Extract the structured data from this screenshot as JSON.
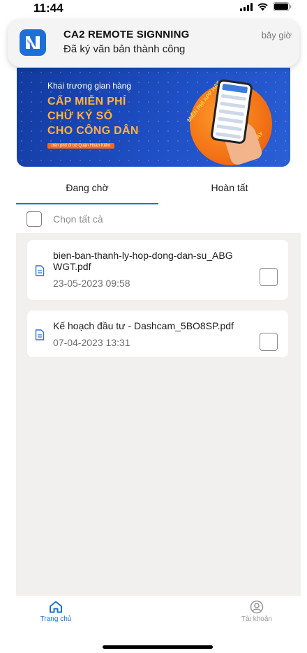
{
  "status_bar": {
    "time": "11:44"
  },
  "notification": {
    "app_name": "CA2 REMOTE SIGNNING",
    "message": "Đã ký văn bản thành công",
    "time": "bây giờ",
    "icon": "app-logo-icon"
  },
  "promo": {
    "kicker": "Khai trương gian hàng",
    "line1": "CẤP MIỄN PHÍ",
    "line2": "CHỮ KÝ SỐ",
    "line3": "CHO CÔNG DÂN",
    "tag": "trên phố đi bộ Quận Hoàn Kiếm",
    "ring_top": "MIỄN PHÍ APP HAY",
    "ring_bottom": "KÍ SỐ LIỀN TAY"
  },
  "tabs": [
    {
      "label": "Đang chờ",
      "active": true
    },
    {
      "label": "Hoàn tất",
      "active": false
    }
  ],
  "select_all": {
    "label": "Chọn tất cả",
    "checked": false
  },
  "documents": [
    {
      "name": "bien-ban-thanh-ly-hop-dong-dan-su_ABGWGT.pdf",
      "date": "23-05-2023 09:58",
      "checked": false,
      "icon": "document-icon"
    },
    {
      "name": "Kế hoạch đầu tư - Dashcam_5BO8SP.pdf",
      "date": "07-04-2023 13:31",
      "checked": false,
      "icon": "document-icon"
    }
  ],
  "bottom_nav": [
    {
      "label": "Trang chủ",
      "icon": "home-icon",
      "active": true
    },
    {
      "label": "Tài khoản",
      "icon": "account-icon",
      "active": false
    }
  ],
  "colors": {
    "accent": "#1f6fd8",
    "list_background": "#f2efef",
    "promo_orange": "#ffb23e"
  }
}
